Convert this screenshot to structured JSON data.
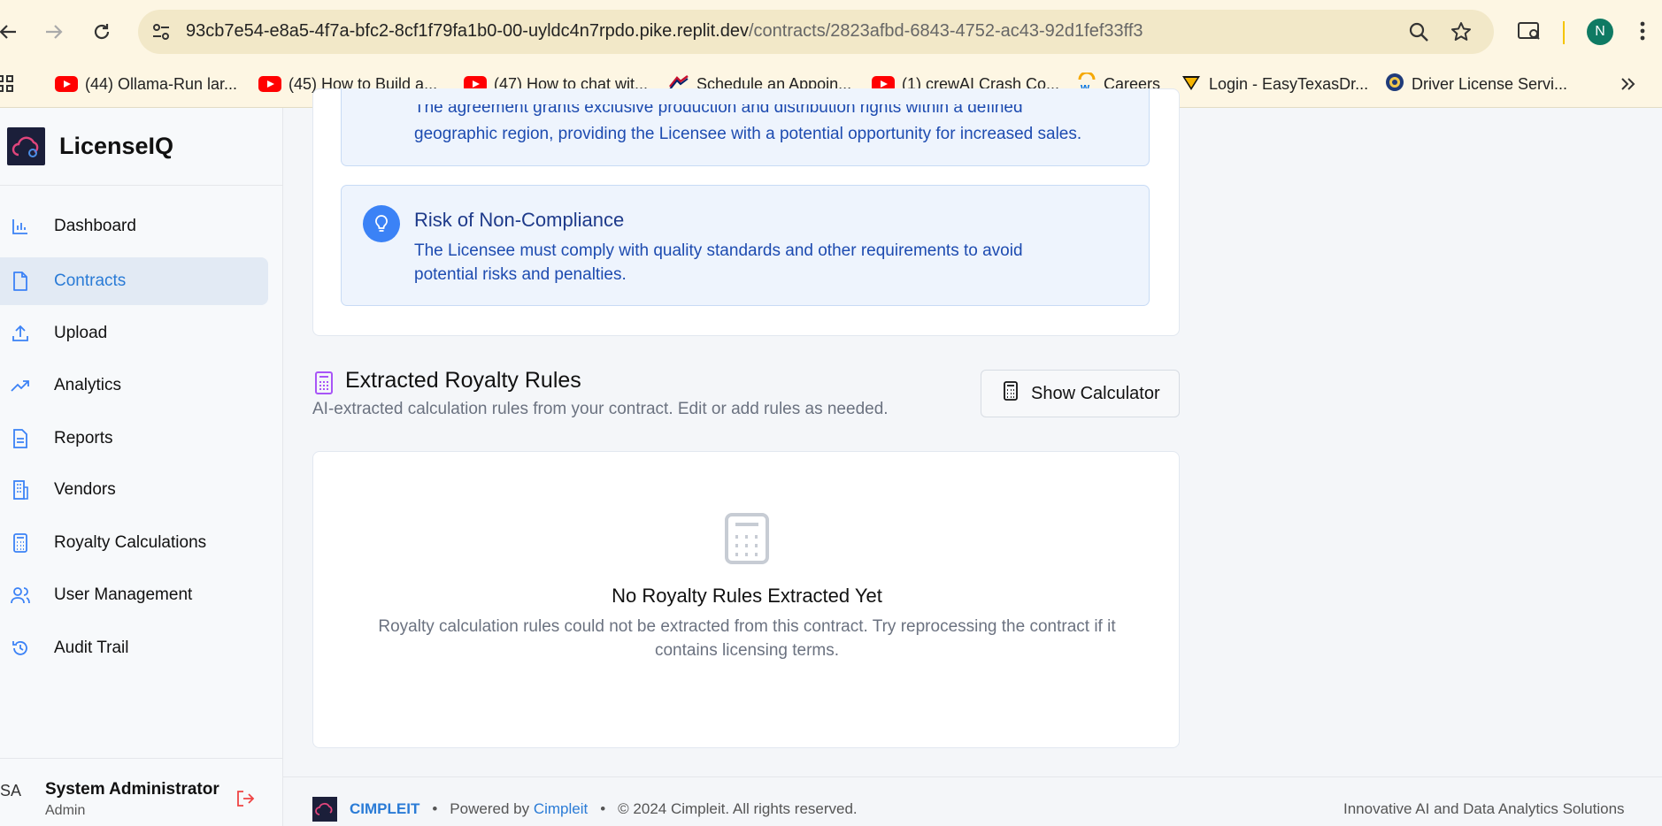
{
  "browser": {
    "url_host": "93cb7e54-e8a5-4f7a-bfc2-8cf1f79fa1b0-00-uyldc4n7rpdo.pike.replit.dev",
    "url_path": "/contracts/2823afbd-6843-4752-ac43-92d1fef33ff3",
    "profile_initial": "N",
    "bookmarks": [
      {
        "label": "(44) Ollama-Run lar...",
        "icon": "youtube-icon"
      },
      {
        "label": "(45) How to Build a...",
        "icon": "youtube-icon"
      },
      {
        "label": "(47) How to chat wit...",
        "icon": "youtube-icon"
      },
      {
        "label": "Schedule an Appoin...",
        "icon": "flag-icon"
      },
      {
        "label": "(1) crewAI Crash Co...",
        "icon": "youtube-icon"
      },
      {
        "label": "Careers",
        "icon": "workday-icon"
      },
      {
        "label": "Login - EasyTexasDr...",
        "icon": "shield-icon"
      },
      {
        "label": "Driver License Servi...",
        "icon": "seal-icon"
      }
    ]
  },
  "sidebar": {
    "brand": "LicenseIQ",
    "items": [
      {
        "label": "Dashboard",
        "icon": "bar-chart-icon"
      },
      {
        "label": "Contracts",
        "icon": "file-icon",
        "active": true
      },
      {
        "label": "Upload",
        "icon": "upload-icon"
      },
      {
        "label": "Analytics",
        "icon": "trending-up-icon"
      },
      {
        "label": "Reports",
        "icon": "document-icon"
      },
      {
        "label": "Vendors",
        "icon": "building-icon"
      },
      {
        "label": "Royalty Calculations",
        "icon": "calculator-icon"
      },
      {
        "label": "User Management",
        "icon": "users-icon"
      },
      {
        "label": "Audit Trail",
        "icon": "history-icon"
      }
    ],
    "user": {
      "initials": "SA",
      "name": "System Administrator",
      "role": "Admin"
    }
  },
  "main": {
    "insight_partial": {
      "line1": "The agreement grants exclusive production and distribution rights within a defined",
      "line2": "geographic region, providing the Licensee with a potential opportunity for increased sales."
    },
    "insight_risk": {
      "title": "Risk of Non-Compliance",
      "line1": "The Licensee must comply with quality standards and other requirements to avoid",
      "line2": "potential risks and penalties."
    },
    "royalty": {
      "title": "Extracted Royalty Rules",
      "subtitle": "AI-extracted calculation rules from your contract. Edit or add rules as needed.",
      "calc_button": "Show Calculator",
      "empty_title": "No Royalty Rules Extracted Yet",
      "empty_line1": "Royalty calculation rules could not be extracted from this contract. Try reprocessing the contract if it",
      "empty_line2": "contains licensing terms."
    }
  },
  "footer": {
    "brand": "CIMPLEIT",
    "dot": "•",
    "powered_prefix": "Powered by",
    "powered_link": "Cimpleit",
    "copyright": "© 2024 Cimpleit. All rights reserved.",
    "tagline": "Innovative AI and Data Analytics Solutions"
  },
  "colors": {
    "accent": "#2a7bd6",
    "insight_bg": "#eef4fd",
    "insight_text": "#1d4bb0",
    "bulb": "#3b82f6"
  }
}
